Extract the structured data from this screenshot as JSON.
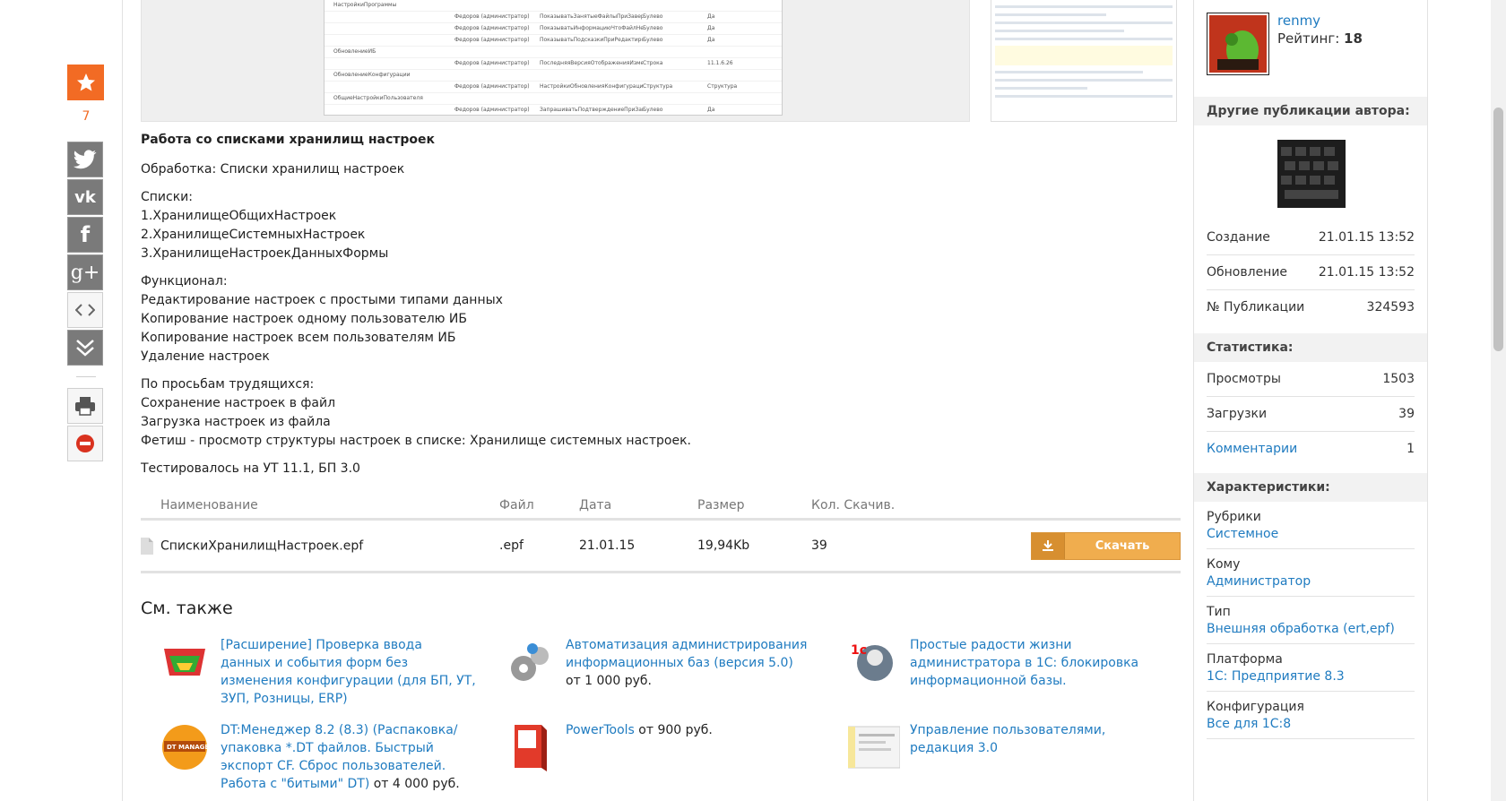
{
  "share": {
    "star_count": "7",
    "buttons": [
      "twitter",
      "vk",
      "facebook",
      "google-plus",
      "embed",
      "expand",
      "print",
      "block"
    ]
  },
  "screenshot_rows": [
    [
      "НастройкиПрограммы",
      "",
      "",
      "",
      ""
    ],
    [
      "",
      "Федоров (администратор)",
      "ПоказыватьЗанятыеФайлыПриЗавершен...",
      "Булево",
      "Да"
    ],
    [
      "",
      "Федоров (администратор)",
      "ПоказыватьИнформациюЧтоФайлНеБыл...",
      "Булево",
      "Да"
    ],
    [
      "",
      "Федоров (администратор)",
      "ПоказыватьПодсказкиПриРедактирова...",
      "Булево",
      "Да"
    ],
    [
      "ОбновлениеИБ",
      "",
      "",
      "",
      ""
    ],
    [
      "",
      "Федоров (администратор)",
      "ПоследняяВерсияОтображенияИзмене...",
      "Строка",
      "11.1.6.26"
    ],
    [
      "ОбновлениеКонфигурации",
      "",
      "",
      "",
      ""
    ],
    [
      "",
      "Федоров (администратор)",
      "НастройкиОбновленияКонфигурации",
      "Структура",
      "Структура"
    ],
    [
      "ОбщиеНастройкиПользователя",
      "",
      "",
      "",
      ""
    ],
    [
      "",
      "Федоров (администратор)",
      "ЗапрашиватьПодтверждениеПриЗаверш...",
      "Булево",
      "Да"
    ]
  ],
  "article": {
    "heading": "Работа со списками хранилищ настроек",
    "p1": "Обработка: Списки хранилищ настроек",
    "lists_title": "Списки:",
    "lists": [
      "1.ХранилищеОбщихНастроек",
      "2.ХранилищеСистемныхНастроек",
      "3.ХранилищеНастроекДанныхФормы"
    ],
    "func_title": "Функционал:",
    "func": [
      "Редактирование настроек с простыми типами данных",
      "Копирование настроек одному пользователю ИБ",
      "Копирование настроек всем пользователям ИБ",
      "Удаление настроек"
    ],
    "req_title": "По просьбам трудящихся:",
    "req": [
      "Сохранение настроек в файл",
      "Загрузка настроек из файла",
      "Фетиш - просмотр структуры настроек в списке: Хранилище системных настроек."
    ],
    "tested": "Тестировалось на УТ 11.1, БП 3.0"
  },
  "files": {
    "headers": [
      "Наименование",
      "Файл",
      "Дата",
      "Размер",
      "Кол. Скачив."
    ],
    "row": {
      "name": "СпискиХранилищНастроек.epf",
      "ext": ".epf",
      "date": "21.01.15",
      "size": "19,94Kb",
      "downloads": "39"
    },
    "download_label": "Скачать"
  },
  "see_also": {
    "title": "См. также",
    "items": [
      {
        "title": "[Расширение] Проверка ввода данных и события форм без изменения конфигурации (для БП, УТ, ЗУП, Розницы, ERP)",
        "price": ""
      },
      {
        "title": "Автоматизация администрирования информационных баз (версия 5.0)",
        "price": "от 1 000 руб."
      },
      {
        "title": "Простые радости жизни администратора в 1С: блокировка информационной базы.",
        "price": ""
      },
      {
        "title": "DT:Менеджер 8.2 (8.3) (Распаковка/упаковка *.DT файлов. Быстрый экспорт CF. Сброс пользователей. Работа с \"битыми\" DT)",
        "price": "от 4 000 руб."
      },
      {
        "title": "PowerTools",
        "price": "от 900 руб."
      },
      {
        "title": "Управление пользователями, редакция 3.0",
        "price": ""
      }
    ]
  },
  "author": {
    "name": "renmy",
    "rating_label": "Рейтинг:",
    "rating": "18"
  },
  "sidebar": {
    "other_pubs": "Другие публикации автора:",
    "meta": [
      {
        "k": "Создание",
        "v": "21.01.15 13:52"
      },
      {
        "k": "Обновление",
        "v": "21.01.15 13:52"
      },
      {
        "k": "№ Публикации",
        "v": "324593"
      }
    ],
    "stats_title": "Статистика:",
    "stats": [
      {
        "k": "Просмотры",
        "v": "1503"
      },
      {
        "k": "Загрузки",
        "v": "39"
      },
      {
        "k": "Комментарии",
        "v": "1"
      }
    ],
    "chars_title": "Характеристики:",
    "chars": [
      {
        "k": "Рубрики",
        "v": "Системное"
      },
      {
        "k": "Кому",
        "v": "Администратор"
      },
      {
        "k": "Тип",
        "v": "Внешняя обработка (ert,epf)"
      },
      {
        "k": "Платформа",
        "v": "1С: Предприятие 8.3"
      },
      {
        "k": "Конфигурация",
        "v": "Все для 1С:8"
      }
    ]
  }
}
